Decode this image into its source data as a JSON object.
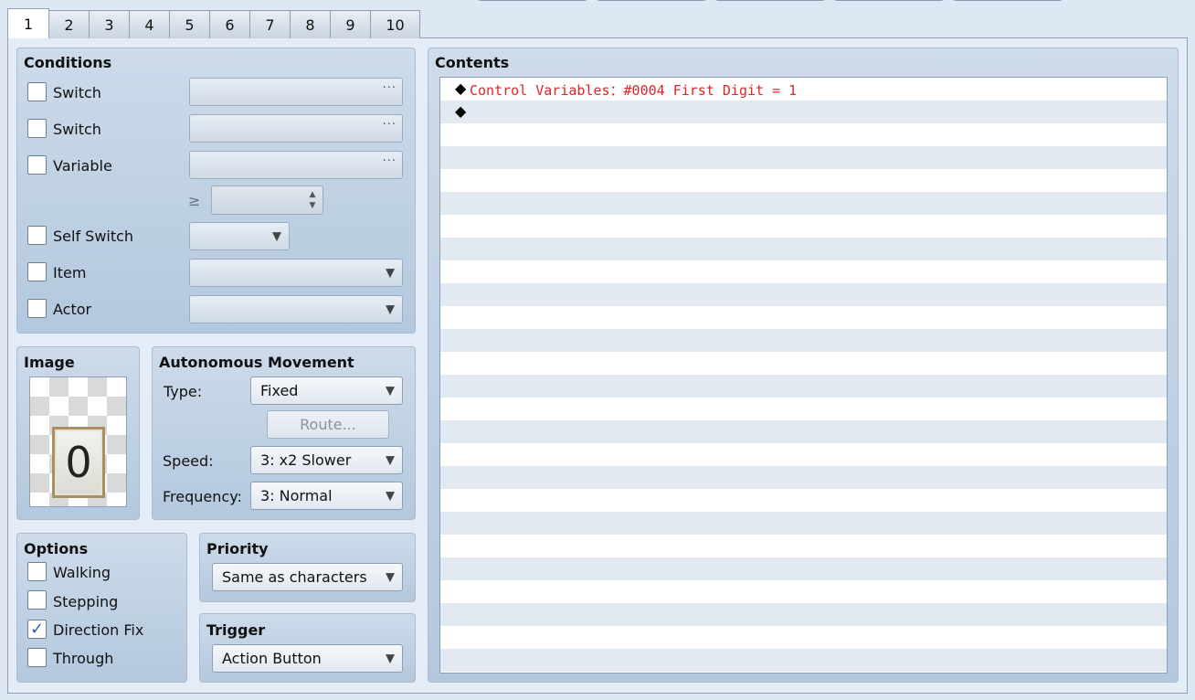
{
  "tabs": [
    "1",
    "2",
    "3",
    "4",
    "5",
    "6",
    "7",
    "8",
    "9",
    "10"
  ],
  "active_tab": "1",
  "conditions": {
    "title": "Conditions",
    "switch1_label": "Switch",
    "switch1_btn": "···",
    "switch2_label": "Switch",
    "switch2_btn": "···",
    "variable_label": "Variable",
    "variable_btn": "···",
    "compare_symbol": "≥",
    "self_switch_label": "Self Switch",
    "item_label": "Item",
    "actor_label": "Actor"
  },
  "image": {
    "title": "Image",
    "tile_text": "0"
  },
  "autonomous": {
    "title": "Autonomous Movement",
    "type_label": "Type:",
    "type_value": "Fixed",
    "route_button": "Route...",
    "speed_label": "Speed:",
    "speed_value": "3: x2 Slower",
    "frequency_label": "Frequency:",
    "frequency_value": "3: Normal"
  },
  "options": {
    "title": "Options",
    "walking": "Walking",
    "stepping": "Stepping",
    "direction_fix": "Direction Fix",
    "through": "Through",
    "direction_fix_checked": "✓"
  },
  "priority": {
    "title": "Priority",
    "value": "Same as characters"
  },
  "trigger": {
    "title": "Trigger",
    "value": "Action Button"
  },
  "contents": {
    "title": "Contents",
    "commands": [
      {
        "marker": "◆",
        "text": "Control Variables：#0004 First Digit = 1"
      },
      {
        "marker": "◆",
        "text": ""
      }
    ]
  },
  "icons": {
    "dropdown_arrow": "▼",
    "spin_arrows": "▲▼"
  }
}
